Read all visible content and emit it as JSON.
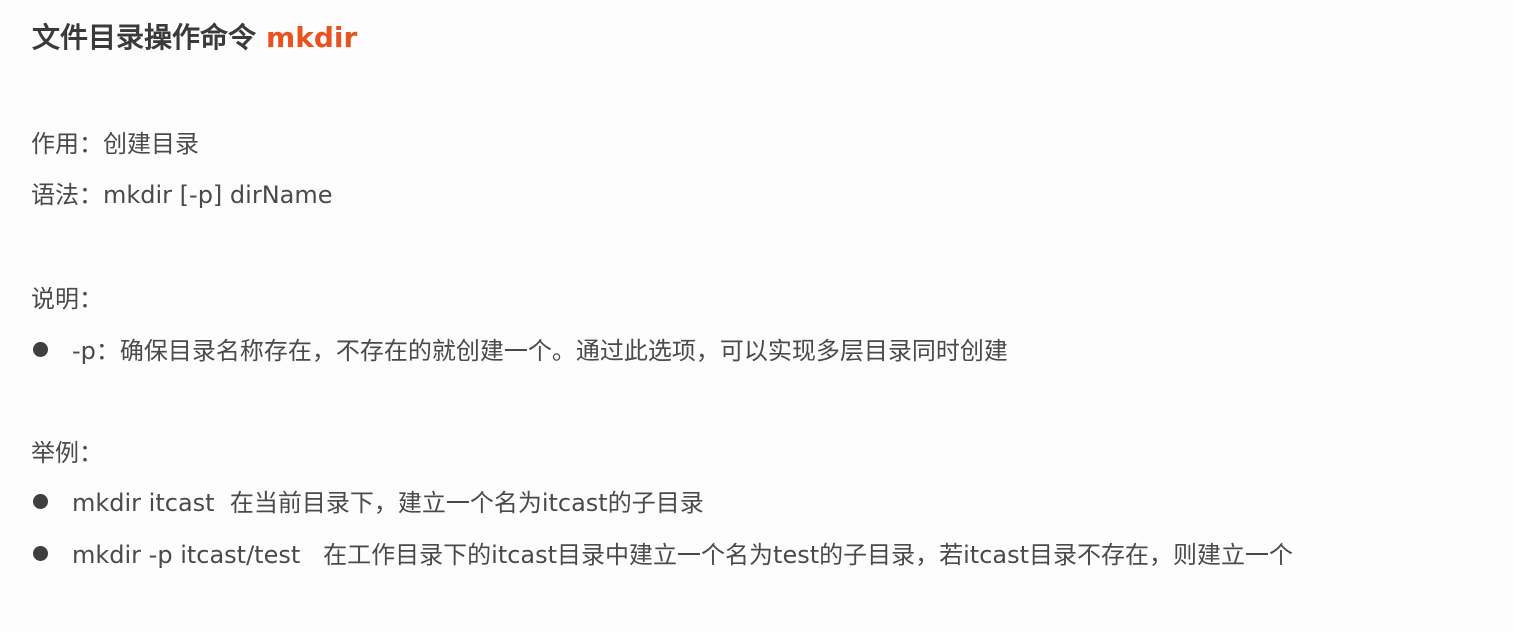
{
  "title": {
    "prefix": "文件目录操作命令",
    "command": "mkdir",
    "accent_color": "#e8531f"
  },
  "purpose": "作用：创建目录",
  "syntax": "语法：mkdir [-p] dirName",
  "notes": {
    "heading": "说明：",
    "items": [
      "-p：确保目录名称存在，不存在的就创建一个。通过此选项，可以实现多层目录同时创建"
    ]
  },
  "examples": {
    "heading": "举例：",
    "items": [
      "mkdir itcast  在当前目录下，建立一个名为itcast的子目录",
      "mkdir -p itcast/test   在工作目录下的itcast目录中建立一个名为test的子目录，若itcast目录不存在，则建立一个"
    ]
  },
  "icons": {
    "bullet": "bullet-dot-icon"
  }
}
